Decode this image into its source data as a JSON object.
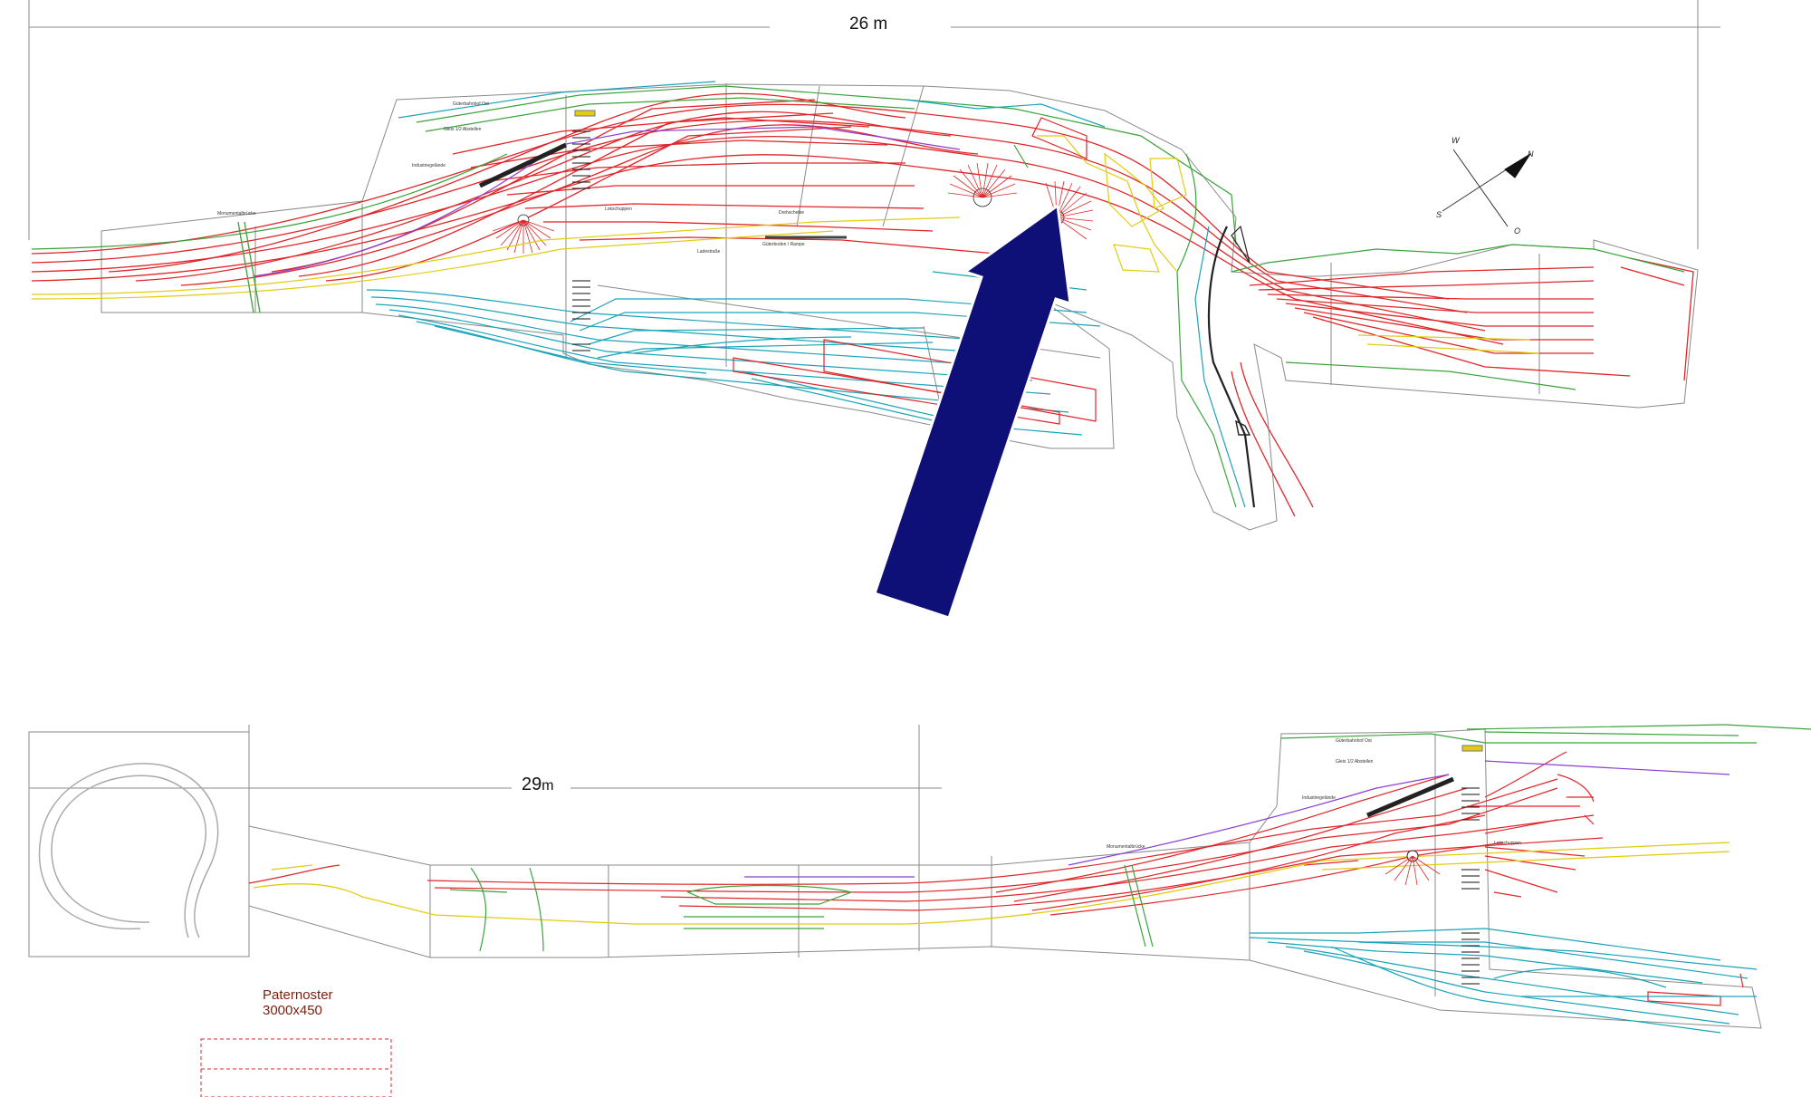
{
  "top_plan": {
    "dimension": "26 m",
    "bridge_label": "Monumentalbrücke",
    "station_labels": [
      "Güterbahnhof Ost",
      "Gleis 1/2 Abstellen",
      "Industriegelände",
      "Lokschuppen",
      "Drehscheibe",
      "Ladestraße",
      "Güterboden / Rampe"
    ]
  },
  "bottom_plan": {
    "dimension": "29",
    "dimension_unit": "m",
    "bridge_label": "Monumentalbrücke",
    "station_labels": [
      "Güterbahnhof Ost",
      "Gleis 1/2 Abstellen",
      "Industriegelände",
      "Lokschuppen"
    ]
  },
  "compass": {
    "w": "W",
    "n": "N",
    "s": "S",
    "o": "O"
  },
  "paternoster": {
    "title": "Paternoster",
    "size": "3000x450"
  },
  "colors": {
    "arrow": "#0f0f78",
    "track_main": "#e0262a",
    "track_yard": "#1aa3b8",
    "track_green": "#3aa33a",
    "track_yellow": "#e2cc10",
    "track_purple": "#8a3fd0",
    "caption": "#7a1f0e",
    "outline": "#7f7f7f"
  }
}
